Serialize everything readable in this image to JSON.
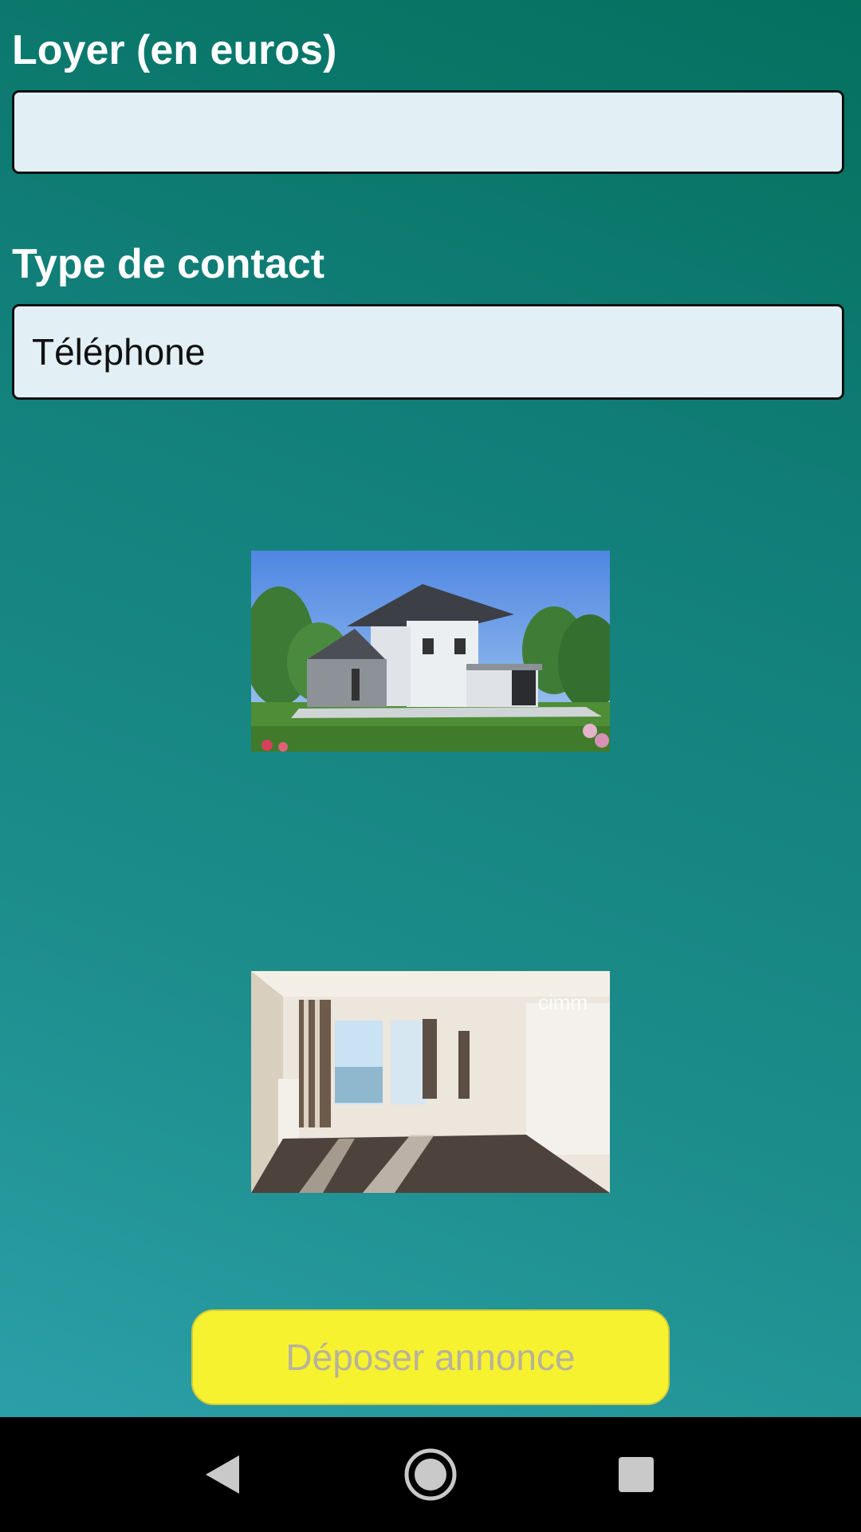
{
  "form": {
    "rent_label": "Loyer (en euros)",
    "rent_value": "",
    "contact_label": "Type de contact",
    "contact_value": "Téléphone"
  },
  "images": {
    "house_photo": "house-exterior",
    "interior_photo": "apartment-interior",
    "interior_watermark": "cimm"
  },
  "actions": {
    "submit_label": "Déposer annonce"
  },
  "navbar": {
    "back": "back-icon",
    "home": "home-icon",
    "recents": "recents-icon"
  },
  "colors": {
    "button_bg": "#f7f230",
    "button_text": "#b7b39a",
    "field_bg": "#e2eff5"
  }
}
